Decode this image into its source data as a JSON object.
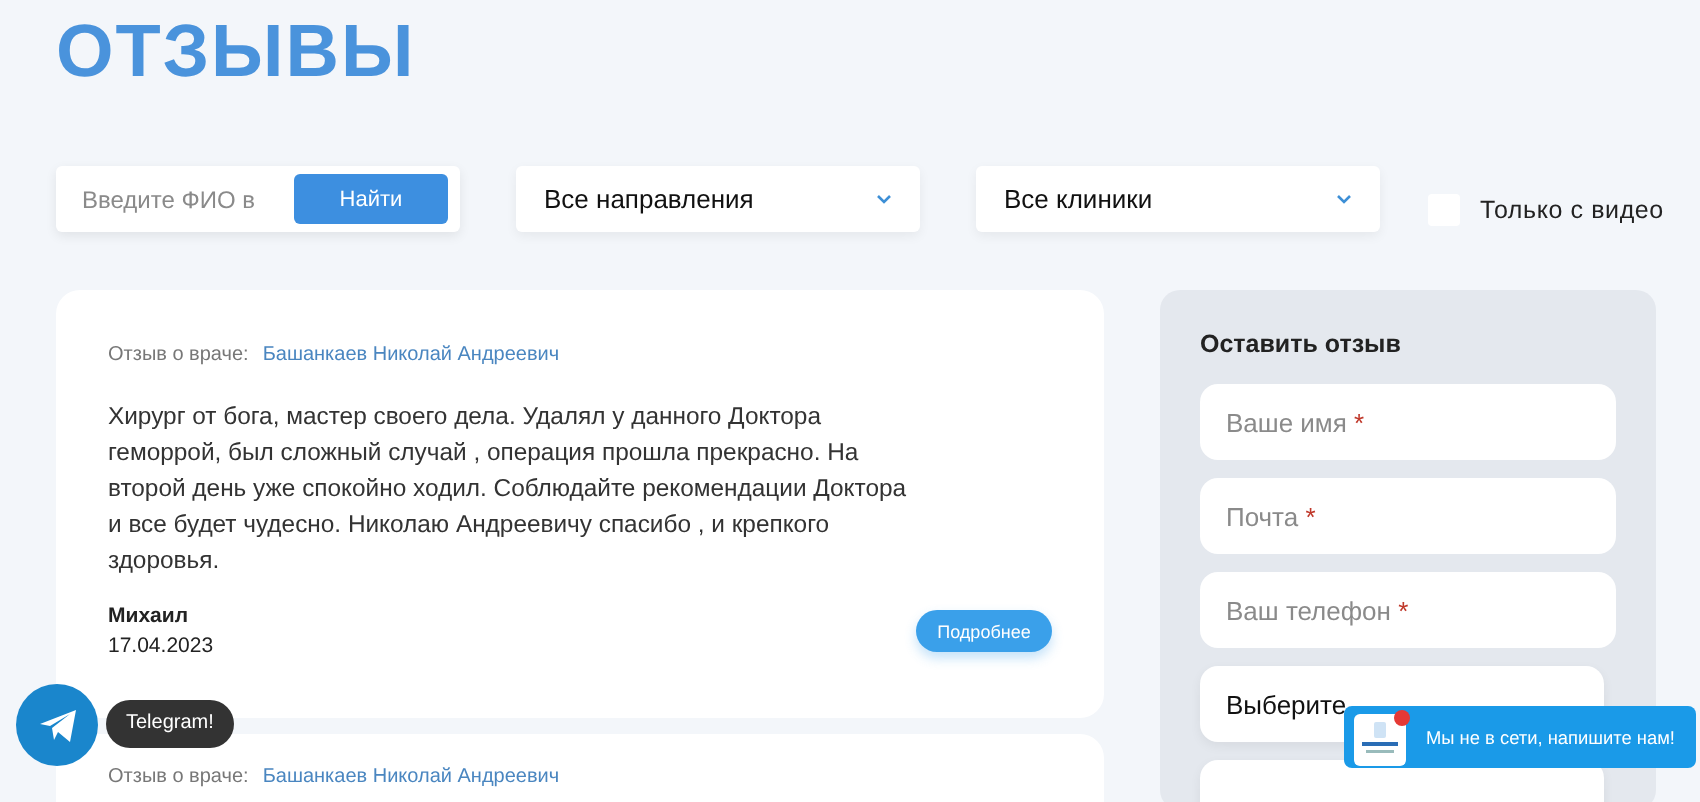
{
  "page": {
    "title": "ОТЗЫВЫ"
  },
  "filters": {
    "search": {
      "placeholder": "Введите ФИО в",
      "button": "Найти"
    },
    "selects": [
      {
        "value": "Все направления"
      },
      {
        "value": "Все клиники"
      }
    ],
    "video_only": {
      "label": "Только с видео",
      "checked": false
    }
  },
  "reviews": [
    {
      "about_label": "Отзыв о враче:",
      "doctor": "Башанкаев Николай Андреевич",
      "text": "Хирург от бога, мастер своего дела. Удалял у данного Доктора геморрой, был сложный случай , операция прошла прекрасно. На второй день уже спокойно ходил. Соблюдайте рекомендации Доктора и все будет чудесно. Николаю Андреевичу спасибо , и крепкого здоровья.",
      "author": "Михаил",
      "date": "17.04.2023",
      "button": "Подробнее"
    },
    {
      "about_label": "Отзыв о враче:",
      "doctor": "Башанкаев Николай Андреевич"
    }
  ],
  "review_form": {
    "title": "Оставить отзыв",
    "fields": [
      {
        "kind": "input",
        "placeholder": "Ваше имя",
        "required_mark": "*"
      },
      {
        "kind": "input",
        "placeholder": "Почта",
        "required_mark": "*"
      },
      {
        "kind": "input",
        "placeholder": "Ваш телефон",
        "required_mark": "*"
      },
      {
        "kind": "select",
        "value": "Выберите"
      },
      {
        "kind": "select"
      }
    ]
  },
  "telegram": {
    "tooltip": "Telegram!"
  },
  "chat_widget": {
    "message": "Мы не в сети, напишите нам!"
  }
}
